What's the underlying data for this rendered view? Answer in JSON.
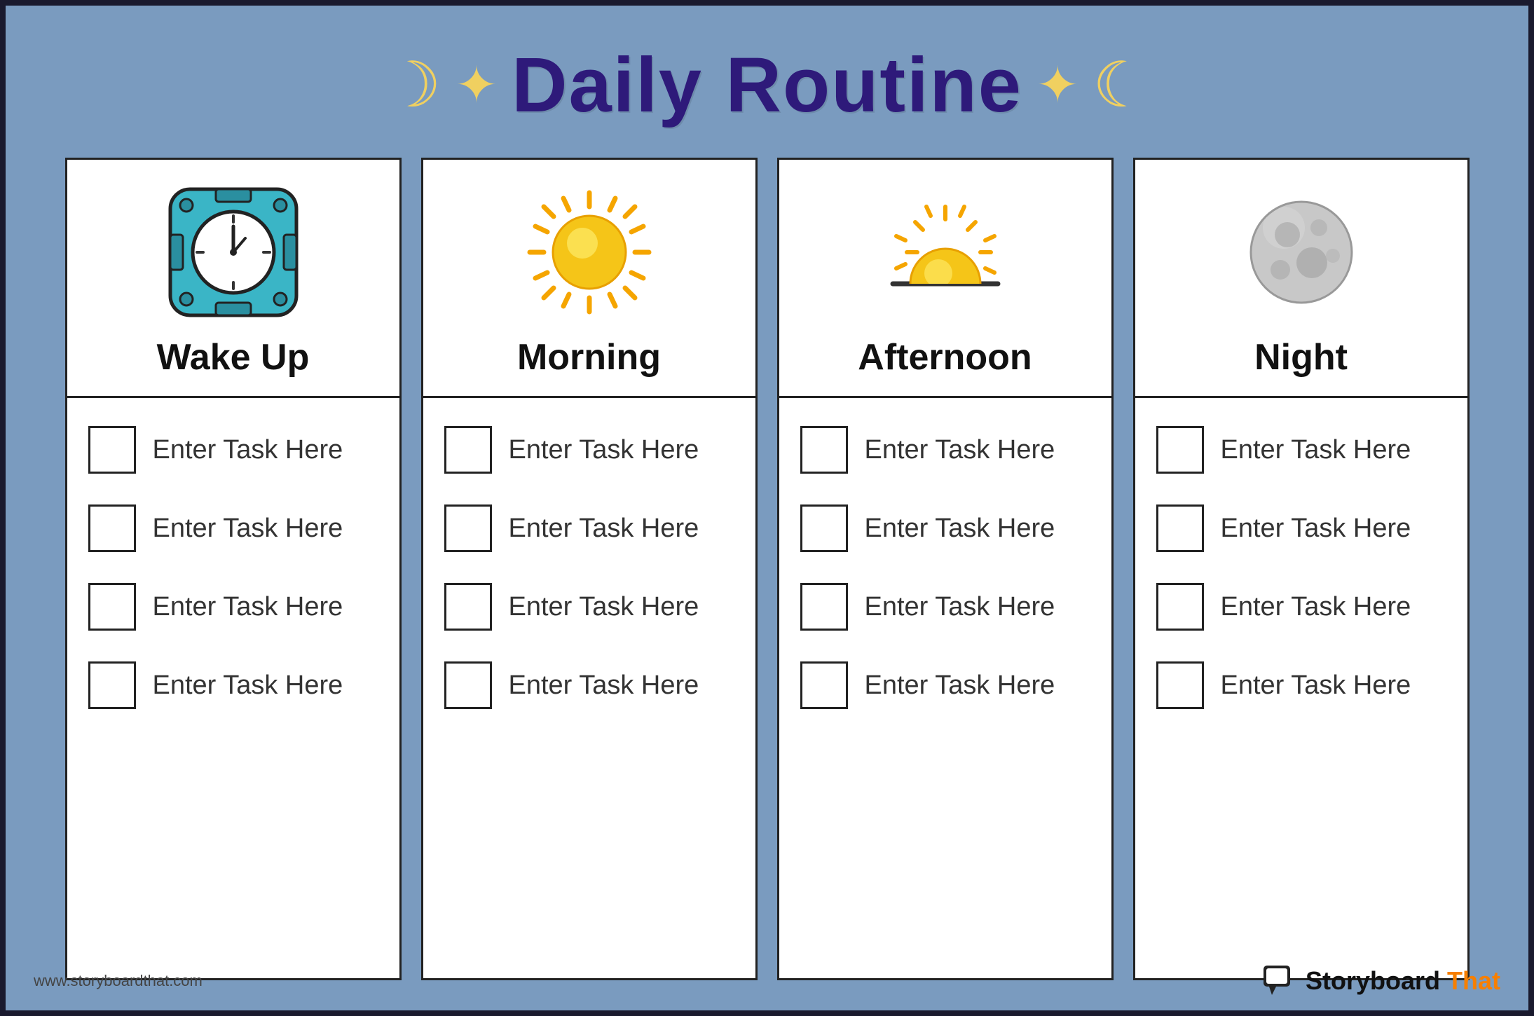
{
  "header": {
    "title": "Daily Routine",
    "moon_symbol": "☽",
    "sun_symbol": "✦"
  },
  "columns": [
    {
      "id": "wake-up",
      "title": "Wake Up",
      "icon_type": "clock",
      "tasks": [
        "Enter Task Here",
        "Enter Task Here",
        "Enter Task Here",
        "Enter Task Here"
      ]
    },
    {
      "id": "morning",
      "title": "Morning",
      "icon_type": "sun",
      "tasks": [
        "Enter Task Here",
        "Enter Task Here",
        "Enter Task Here",
        "Enter Task Here"
      ]
    },
    {
      "id": "afternoon",
      "title": "Afternoon",
      "icon_type": "afternoon-sun",
      "tasks": [
        "Enter Task Here",
        "Enter Task Here",
        "Enter Task Here",
        "Enter Task Here"
      ]
    },
    {
      "id": "night",
      "title": "Night",
      "icon_type": "moon",
      "tasks": [
        "Enter Task Here",
        "Enter Task Here",
        "Enter Task Here",
        "Enter Task Here"
      ]
    }
  ],
  "footer": {
    "url": "www.storyboardthat.com",
    "brand_story": "Storyboard",
    "brand_that": "That"
  }
}
